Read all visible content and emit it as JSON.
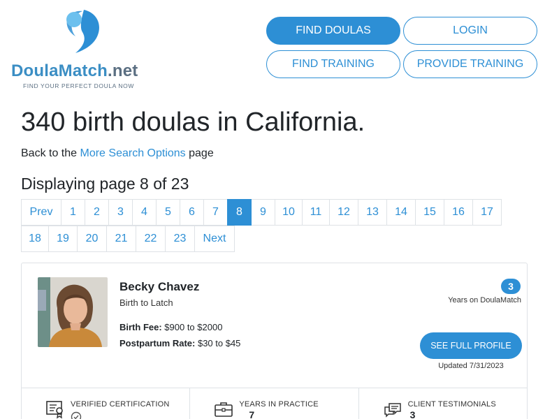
{
  "brand": {
    "name_part1": "Doula",
    "name_part2": "Match",
    "name_part3": ".net",
    "tagline": "FIND YOUR PERFECT DOULA NOW",
    "primary_color": "#2d8fd5",
    "logo_light_color": "#6cc0ee"
  },
  "nav": {
    "find_doulas": "FIND DOULAS",
    "login": "LOGIN",
    "find_training": "FIND TRAINING",
    "provide_training": "PROVIDE TRAINING"
  },
  "heading": {
    "title": "340 birth doulas in California.",
    "back_prefix": "Back to the ",
    "back_link": "More Search Options",
    "back_suffix": " page",
    "display": "Displaying page 8 of 23"
  },
  "pagination": {
    "row1": [
      "Prev",
      "1",
      "2",
      "3",
      "4",
      "5",
      "6",
      "7",
      "8",
      "9",
      "10",
      "11",
      "12",
      "13",
      "14",
      "15",
      "16",
      "17"
    ],
    "row2": [
      "18",
      "19",
      "20",
      "21",
      "22",
      "23",
      "Next"
    ],
    "current": "8"
  },
  "card": {
    "name": "Becky Chavez",
    "business": "Birth to Latch",
    "birth_fee_label": "Birth Fee:",
    "birth_fee_value": " $900 to $2000",
    "postpartum_label": "Postpartum Rate:",
    "postpartum_value": " $30 to $45",
    "years_badge": "3",
    "years_label": "Years on DoulaMatch",
    "profile_button": "SEE FULL PROFILE",
    "updated": "Updated 7/31/2023",
    "stats": [
      {
        "label": "VERIFIED CERTIFICATION",
        "value": "",
        "icon": "certificate-icon"
      },
      {
        "label": "YEARS IN PRACTICE",
        "value": "7",
        "icon": "briefcase-icon"
      },
      {
        "label": "CLIENT TESTIMONIALS",
        "value": "3",
        "icon": "chat-icon"
      }
    ]
  }
}
